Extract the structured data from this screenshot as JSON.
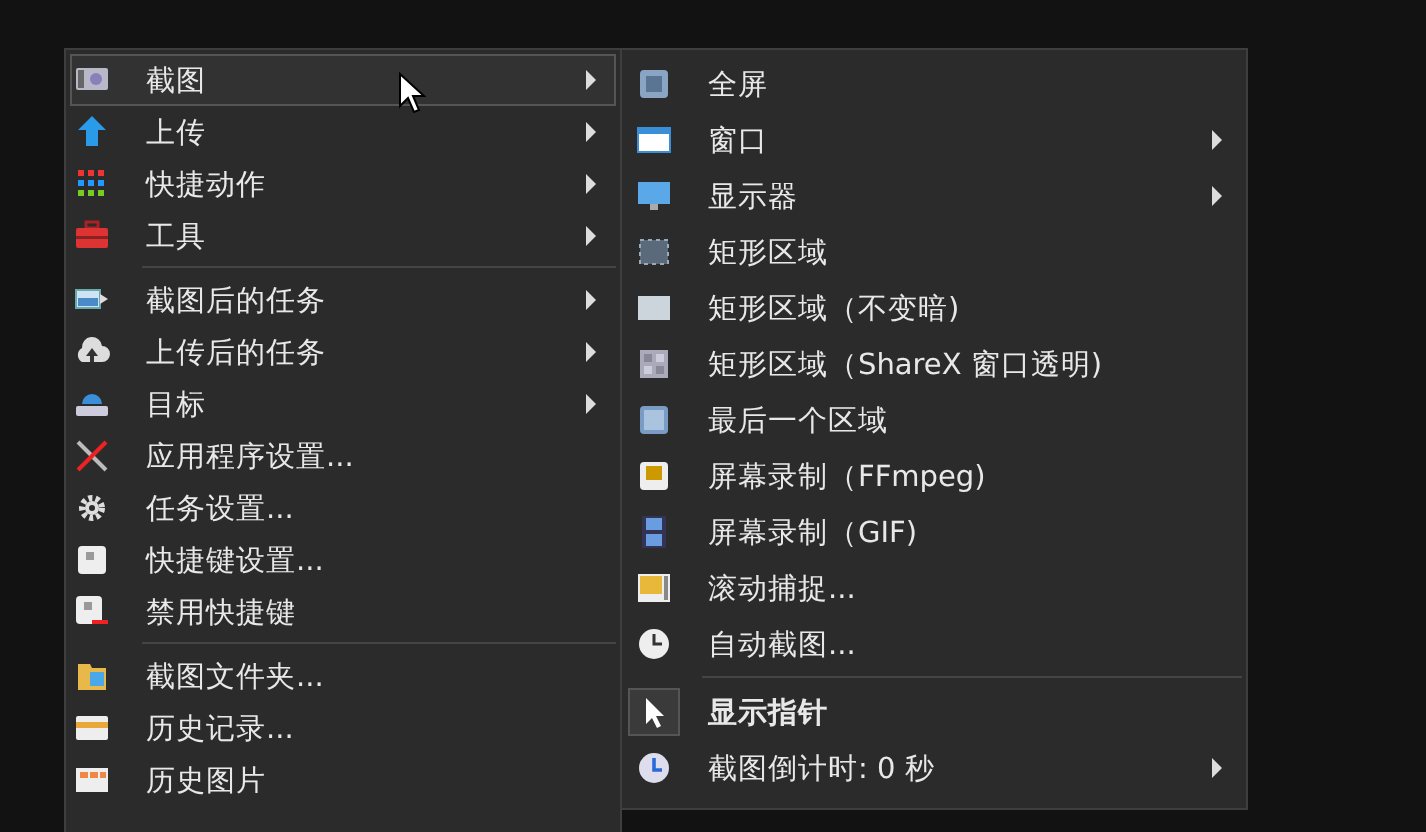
{
  "main_menu": {
    "items": [
      {
        "kind": "item",
        "label": "截图",
        "has_submenu": true,
        "selected": true
      },
      {
        "kind": "item",
        "label": "上传",
        "has_submenu": true,
        "selected": false
      },
      {
        "kind": "item",
        "label": "快捷动作",
        "has_submenu": true,
        "selected": false
      },
      {
        "kind": "item",
        "label": "工具",
        "has_submenu": true,
        "selected": false
      },
      {
        "kind": "separator"
      },
      {
        "kind": "item",
        "label": "截图后的任务",
        "has_submenu": true,
        "selected": false
      },
      {
        "kind": "item",
        "label": "上传后的任务",
        "has_submenu": true,
        "selected": false
      },
      {
        "kind": "item",
        "label": "目标",
        "has_submenu": true,
        "selected": false
      },
      {
        "kind": "item",
        "label": "应用程序设置...",
        "has_submenu": false,
        "selected": false
      },
      {
        "kind": "item",
        "label": "任务设置...",
        "has_submenu": false,
        "selected": false
      },
      {
        "kind": "item",
        "label": "快捷键设置...",
        "has_submenu": false,
        "selected": false
      },
      {
        "kind": "item",
        "label": "禁用快捷键",
        "has_submenu": false,
        "selected": false
      },
      {
        "kind": "separator"
      },
      {
        "kind": "item",
        "label": "截图文件夹...",
        "has_submenu": false,
        "selected": false
      },
      {
        "kind": "item",
        "label": "历史记录...",
        "has_submenu": false,
        "selected": false
      },
      {
        "kind": "item",
        "label": "历史图片",
        "has_submenu": false,
        "selected": false
      }
    ]
  },
  "submenu": {
    "items": [
      {
        "kind": "item",
        "label": "全屏",
        "has_submenu": false,
        "checked": false
      },
      {
        "kind": "item",
        "label": "窗口",
        "has_submenu": true,
        "checked": false
      },
      {
        "kind": "item",
        "label": "显示器",
        "has_submenu": true,
        "checked": false
      },
      {
        "kind": "item",
        "label": "矩形区域",
        "has_submenu": false,
        "checked": false
      },
      {
        "kind": "item",
        "label": "矩形区域（不变暗)",
        "has_submenu": false,
        "checked": false
      },
      {
        "kind": "item",
        "label": "矩形区域（ShareX 窗口透明)",
        "has_submenu": false,
        "checked": false
      },
      {
        "kind": "item",
        "label": "最后一个区域",
        "has_submenu": false,
        "checked": false
      },
      {
        "kind": "item",
        "label": "屏幕录制（FFmpeg)",
        "has_submenu": false,
        "checked": false
      },
      {
        "kind": "item",
        "label": "屏幕录制（GIF)",
        "has_submenu": false,
        "checked": false
      },
      {
        "kind": "item",
        "label": "滚动捕捉...",
        "has_submenu": false,
        "checked": false
      },
      {
        "kind": "item",
        "label": "自动截图...",
        "has_submenu": false,
        "checked": false
      },
      {
        "kind": "separator"
      },
      {
        "kind": "item",
        "label": "显示指针",
        "has_submenu": false,
        "checked": true
      },
      {
        "kind": "item",
        "label": "截图倒计时: 0 秒",
        "has_submenu": true,
        "checked": false
      }
    ]
  }
}
